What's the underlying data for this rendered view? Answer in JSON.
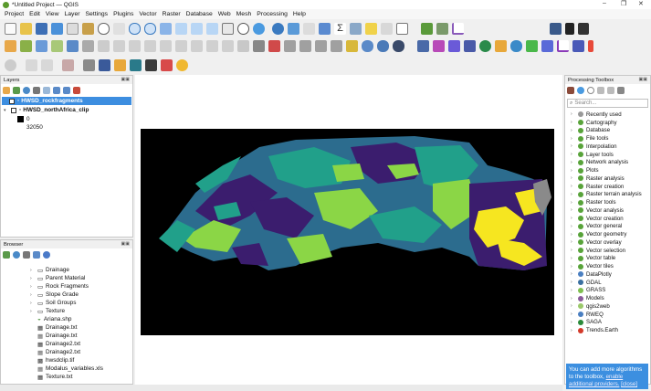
{
  "window": {
    "title": "*Untitled Project — QGIS",
    "minimize": "–",
    "maximize": "❐",
    "close": "✕"
  },
  "menu": [
    "Project",
    "Edit",
    "View",
    "Layer",
    "Settings",
    "Plugins",
    "Vector",
    "Raster",
    "Database",
    "Web",
    "Mesh",
    "Processing",
    "Help"
  ],
  "layers_panel": {
    "title": "Layers",
    "items": [
      {
        "label": "HWSD_rockfragments",
        "checked": true,
        "selected": true
      },
      {
        "label": "HWSD_northAfrica_clip",
        "checked": true,
        "selected": false
      }
    ],
    "legend": [
      {
        "value": "0",
        "color": "#000000"
      },
      {
        "value": "32050",
        "color": "#ffffff"
      }
    ]
  },
  "browser_panel": {
    "title": "Browser",
    "items": [
      {
        "label": "Drainage",
        "type": "folder"
      },
      {
        "label": "Parent Material",
        "type": "folder"
      },
      {
        "label": "Rock Fragments",
        "type": "folder"
      },
      {
        "label": "Slope Grade",
        "type": "folder"
      },
      {
        "label": "Soil Groups",
        "type": "folder"
      },
      {
        "label": "Texture",
        "type": "folder"
      },
      {
        "label": "Ariana.shp",
        "type": "vector"
      },
      {
        "label": "Drainage.txt",
        "type": "table"
      },
      {
        "label": "Drainage.txt",
        "type": "table"
      },
      {
        "label": "Drainage2.txt",
        "type": "table"
      },
      {
        "label": "Drainage2.txt",
        "type": "table"
      },
      {
        "label": "hwsdclip.tif",
        "type": "raster"
      },
      {
        "label": "Modalus_variables.xls",
        "type": "table"
      },
      {
        "label": "Texture.txt",
        "type": "table"
      }
    ]
  },
  "processing_toolbox": {
    "title": "Processing Toolbox",
    "search_placeholder": "Search...",
    "items": [
      {
        "label": "Recently used",
        "color": "#999999"
      },
      {
        "label": "Cartography",
        "color": "#58a33a"
      },
      {
        "label": "Database",
        "color": "#58a33a"
      },
      {
        "label": "File tools",
        "color": "#58a33a"
      },
      {
        "label": "Interpolation",
        "color": "#58a33a"
      },
      {
        "label": "Layer tools",
        "color": "#58a33a"
      },
      {
        "label": "Network analysis",
        "color": "#58a33a"
      },
      {
        "label": "Plots",
        "color": "#58a33a"
      },
      {
        "label": "Raster analysis",
        "color": "#58a33a"
      },
      {
        "label": "Raster creation",
        "color": "#58a33a"
      },
      {
        "label": "Raster terrain analysis",
        "color": "#58a33a"
      },
      {
        "label": "Raster tools",
        "color": "#58a33a"
      },
      {
        "label": "Vector analysis",
        "color": "#58a33a"
      },
      {
        "label": "Vector creation",
        "color": "#58a33a"
      },
      {
        "label": "Vector general",
        "color": "#58a33a"
      },
      {
        "label": "Vector geometry",
        "color": "#58a33a"
      },
      {
        "label": "Vector overlay",
        "color": "#58a33a"
      },
      {
        "label": "Vector selection",
        "color": "#58a33a"
      },
      {
        "label": "Vector table",
        "color": "#58a33a"
      },
      {
        "label": "Vector tiles",
        "color": "#58a33a"
      },
      {
        "label": "DataPlotly",
        "color": "#4a7fc1"
      },
      {
        "label": "GDAL",
        "color": "#3a6fa0"
      },
      {
        "label": "GRASS",
        "color": "#7fbf4f"
      },
      {
        "label": "Models",
        "color": "#8a5a9a"
      },
      {
        "label": "qgis2web",
        "color": "#9bc86a"
      },
      {
        "label": "RWEQ",
        "color": "#4a7fc1"
      },
      {
        "label": "SAGA",
        "color": "#2a8a3a"
      },
      {
        "label": "Trends.Earth",
        "color": "#d33a2a"
      }
    ],
    "message": "You can add more algorithms to the toolbox,",
    "message_link": "enable additional providers.",
    "message_close": "[close]"
  },
  "colors": {
    "selection": "#3d8ee0",
    "map_purple": "#3b1d6e",
    "map_blue": "#2c6c8e",
    "map_teal": "#21a08a",
    "map_green": "#8bd646",
    "map_yellow": "#f6e620"
  }
}
